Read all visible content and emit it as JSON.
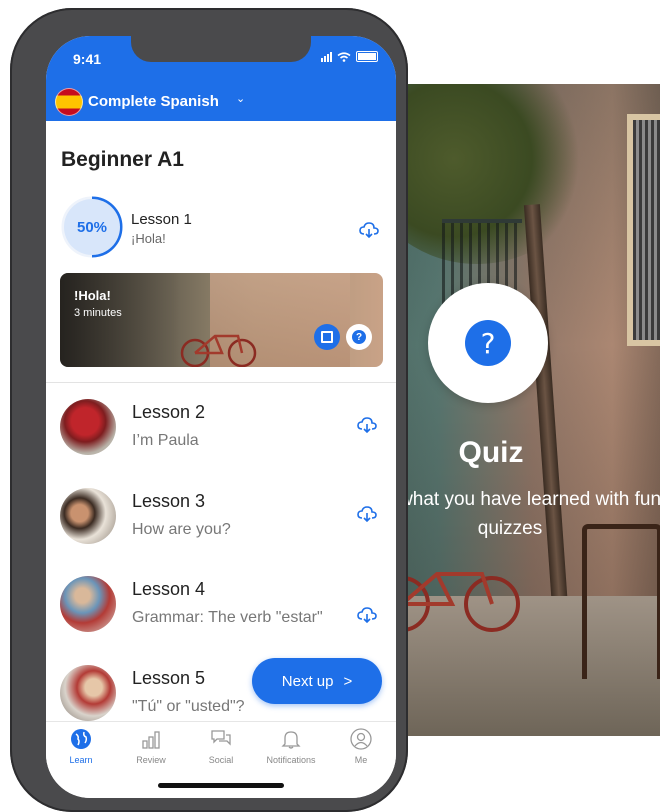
{
  "status_bar": {
    "time": "9:41"
  },
  "header": {
    "course_title": "Complete Spanish",
    "caret": "ˇ",
    "flag_icon": "spain-flag-icon"
  },
  "level": {
    "title": "Beginner A1"
  },
  "lesson1": {
    "progress": "50%",
    "progress_value": 0.5,
    "title": "Lesson 1",
    "subtitle": "¡Hola!"
  },
  "video_card": {
    "title": "!Hola!",
    "duration": "3 minutes"
  },
  "lessons": [
    {
      "title": "Lesson 2",
      "subtitle": "I’m Paula"
    },
    {
      "title": "Lesson 3",
      "subtitle": "How are you?"
    },
    {
      "title": "Lesson 4",
      "subtitle": "Grammar: The verb \"estar\""
    },
    {
      "title": "Lesson 5",
      "subtitle": "\"Tú\" or \"usted\"?"
    }
  ],
  "next_button": {
    "label": "Next up",
    "arrow": ">"
  },
  "tabs": [
    {
      "label": "Learn",
      "icon": "globe-icon",
      "active": true
    },
    {
      "label": "Review",
      "icon": "bar-chart-icon",
      "active": false
    },
    {
      "label": "Social",
      "icon": "chat-bubbles-icon",
      "active": false
    },
    {
      "label": "Notifications",
      "icon": "bell-icon",
      "active": false
    },
    {
      "label": "Me",
      "icon": "person-icon",
      "active": false
    }
  ],
  "quiz_panel": {
    "title": "Quiz",
    "description": "Test what you have learned with fun quizzes",
    "icon": "?"
  },
  "colors": {
    "primary": "#1e6fe8",
    "progress_bg": "#d8e6fa"
  }
}
